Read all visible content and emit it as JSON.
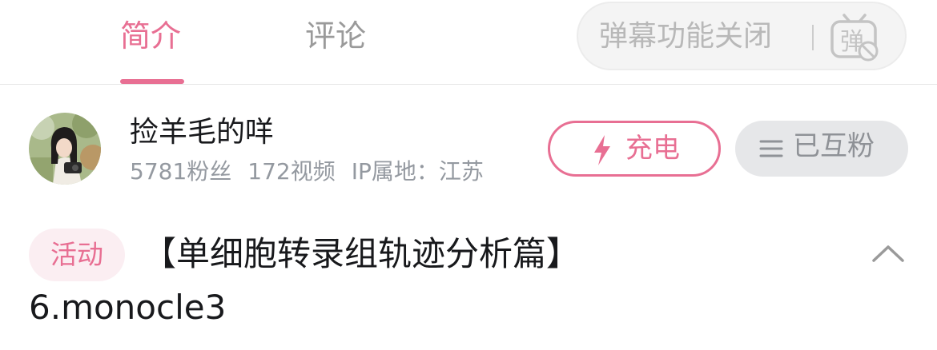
{
  "tabs": [
    {
      "label": "简介",
      "active": true
    },
    {
      "label": "评论",
      "active": false
    }
  ],
  "danmaku": {
    "label": "弹幕功能关闭",
    "icon_glyph": "弹",
    "icon": "danmaku-off-icon"
  },
  "uploader": {
    "name": "捡羊毛的咩",
    "fans": "5781粉丝",
    "videos": "172视频",
    "ip": "IP属地：江苏",
    "avatar_icon": "avatar-photo"
  },
  "actions": {
    "charge_label": "充电",
    "charge_icon": "lightning-icon",
    "follow_label": "已互粉",
    "follow_icon": "menu-lines-icon"
  },
  "video": {
    "tag": "活动",
    "title_line1": "【单细胞转录组轨迹分析篇】",
    "title_line2": "6.monocle3",
    "expand_icon": "chevron-up-icon"
  },
  "colors": {
    "accent": "#e86f93",
    "muted": "#9499a0",
    "tag_bg": "#fbeef2"
  }
}
